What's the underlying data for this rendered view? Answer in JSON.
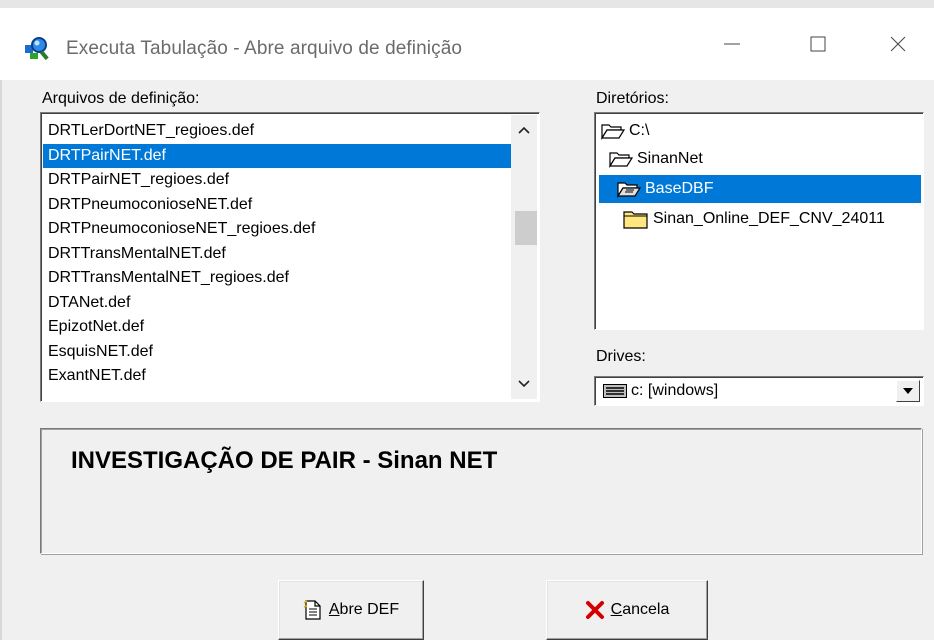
{
  "window": {
    "title": "Executa Tabulação - Abre arquivo de definição",
    "controls": {
      "minimize": "—",
      "maximize": "☐",
      "close": "✕"
    }
  },
  "files": {
    "label": "Arquivos de definição:",
    "items": [
      "DRTLerDortNET_regioes.def",
      "DRTPairNET.def",
      "DRTPairNET_regioes.def",
      "DRTPneumoconioseNET.def",
      "DRTPneumoconioseNET_regioes.def",
      "DRTTransMentalNET.def",
      "DRTTransMentalNET_regioes.def",
      "DTANet.def",
      "EpizotNet.def",
      "EsquisNET.def",
      "ExantNET.def"
    ],
    "selected_index": 1
  },
  "directories": {
    "label": "Diretórios:",
    "items": [
      "C:\\",
      "SinanNet",
      "BaseDBF",
      "Sinan_Online_DEF_CNV_24011"
    ],
    "selected_index": 2
  },
  "drives": {
    "label": "Drives:",
    "value": "c: [windows]"
  },
  "description": "INVESTIGAÇÃO DE PAIR - Sinan NET",
  "buttons": {
    "open_prefix": "A",
    "open_rest": "bre DEF",
    "cancel_prefix": "C",
    "cancel_rest": "ancela"
  },
  "colors": {
    "selection": "#0078d7",
    "cancel_x": "#d40000",
    "folder": "#ffe680"
  }
}
